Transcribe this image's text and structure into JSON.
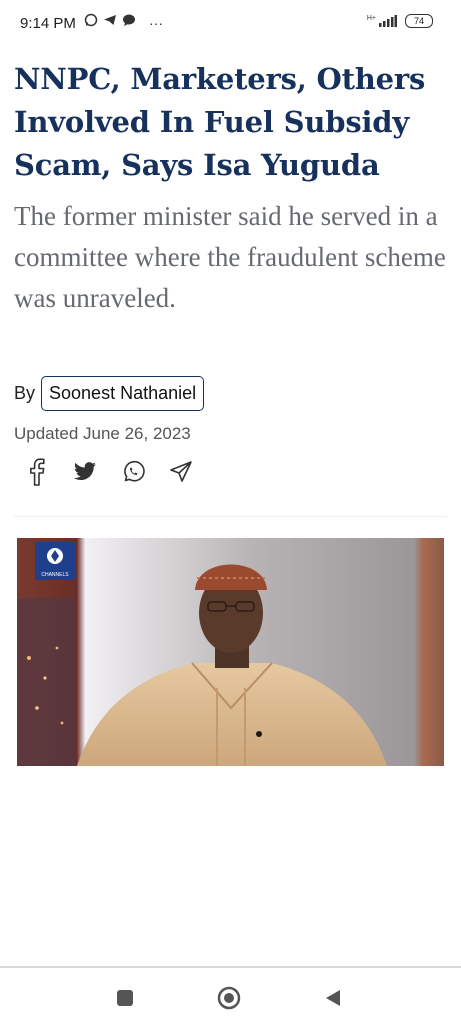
{
  "status_bar": {
    "time": "9:14 PM",
    "overflow": "···",
    "network": "H+",
    "battery": "74",
    "icons": [
      "whatsapp-icon",
      "telegram-icon",
      "chat-icon",
      "signal-icon",
      "battery-icon"
    ]
  },
  "article": {
    "headline": "NNPC, Marketers, Others Involved In Fuel Subsidy Scam, Says Isa Yuguda",
    "subtitle": "The former minister said he served in a committee where the fraudulent scheme was unraveled.",
    "by_label": "By",
    "author": "Soonest Nathaniel",
    "updated": "Updated June 26, 2023",
    "share_icons": [
      "facebook-icon",
      "twitter-icon",
      "whatsapp-icon",
      "send-icon"
    ],
    "image_logo_text": "CHANNELS"
  },
  "nav": {
    "icons": [
      "square-icon",
      "home-circle-icon",
      "back-triangle-icon"
    ]
  },
  "colors": {
    "headline": "#16325c",
    "subtitle": "#666a70",
    "chip_border": "#16325c"
  }
}
